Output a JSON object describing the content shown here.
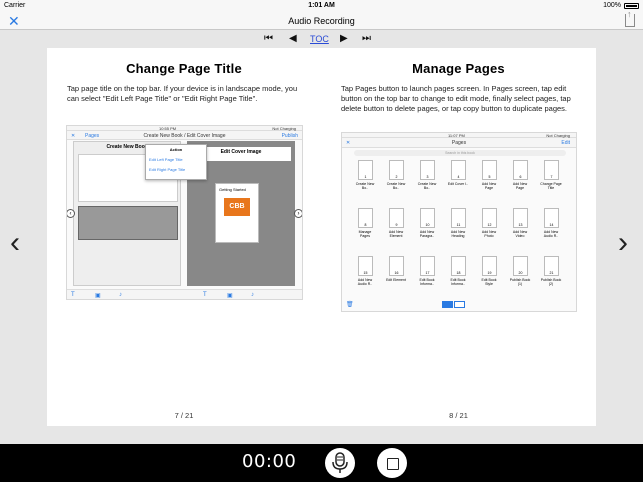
{
  "status_bar": {
    "carrier": "Carrier",
    "time": "1:01 AM",
    "battery": "100%"
  },
  "nav": {
    "title": "Audio Recording"
  },
  "pager": {
    "toc_label": "TOC"
  },
  "left_page": {
    "title": "Change Page Title",
    "body": "Tap page title on the top bar. If your device is in landscape mode, you can select \"Edit Left Page Title\" or \"Edit Right Page Title\".",
    "page_number": "7 / 21",
    "shot": {
      "status_time": "10:55 PM",
      "status_right": "Not Charging",
      "pages_label": "Pages",
      "title_bar": "Create New Book / Edit Cover Image",
      "publish_label": "Publish",
      "left_heading": "Create New Book",
      "right_heading": "Edit Cover Image",
      "action_title": "Action",
      "action_item_1": "Edit Left Page Title",
      "action_item_2": "Edit Right Page Title",
      "cover_logo": "CBB",
      "getting_started": "Getting Started"
    }
  },
  "right_page": {
    "title": "Manage Pages",
    "body": "Tap Pages button to launch pages screen. In Pages screen, tap edit button on the top bar to change to edit mode, finally select pages, tap delete button to delete pages, or tap copy button to duplicate pages.",
    "page_number": "8 / 21",
    "shot": {
      "status_time": "11:07 PM",
      "status_right": "Not Charging",
      "title": "Pages",
      "edit_label": "Edit",
      "search_placeholder": "Search in this book",
      "tiles": [
        {
          "num": "1",
          "label": "Create New Bo.."
        },
        {
          "num": "2",
          "label": "Create New Bo.."
        },
        {
          "num": "3",
          "label": "Create New Bo.."
        },
        {
          "num": "4",
          "label": "Edit Cover I.."
        },
        {
          "num": "5",
          "label": "Add New Page"
        },
        {
          "num": "6",
          "label": "Add New Page"
        },
        {
          "num": "7",
          "label": "Change Page Title"
        },
        {
          "num": "8",
          "label": "Manage Pages"
        },
        {
          "num": "9",
          "label": "Add New Element"
        },
        {
          "num": "10",
          "label": "Add New Paragra.."
        },
        {
          "num": "11",
          "label": "Add New Heading"
        },
        {
          "num": "12",
          "label": "Add New Photo"
        },
        {
          "num": "13",
          "label": "Add New Video"
        },
        {
          "num": "14",
          "label": "Add New Audio R.."
        },
        {
          "num": "15",
          "label": "Add New Audio R.."
        },
        {
          "num": "16",
          "label": "Edit Element"
        },
        {
          "num": "17",
          "label": "Edit Book Informa.."
        },
        {
          "num": "18",
          "label": "Edit Book Informa.."
        },
        {
          "num": "19",
          "label": "Edit Book Style"
        },
        {
          "num": "20",
          "label": "Publish Book (1)"
        },
        {
          "num": "21",
          "label": "Publish Book (2)"
        }
      ]
    }
  },
  "recorder": {
    "time": "00:00"
  },
  "icons": {
    "close": "close-icon",
    "share": "share-icon",
    "first": "first-page-icon",
    "prev": "prev-page-icon",
    "next": "next-page-icon",
    "last": "last-page-icon",
    "mic": "microphone-icon",
    "stop": "stop-icon"
  },
  "colors": {
    "accent": "#2a7ae2",
    "toc_link": "#2a4bd6",
    "bottom_bar": "#000000",
    "cbb_orange": "#e8761c"
  }
}
